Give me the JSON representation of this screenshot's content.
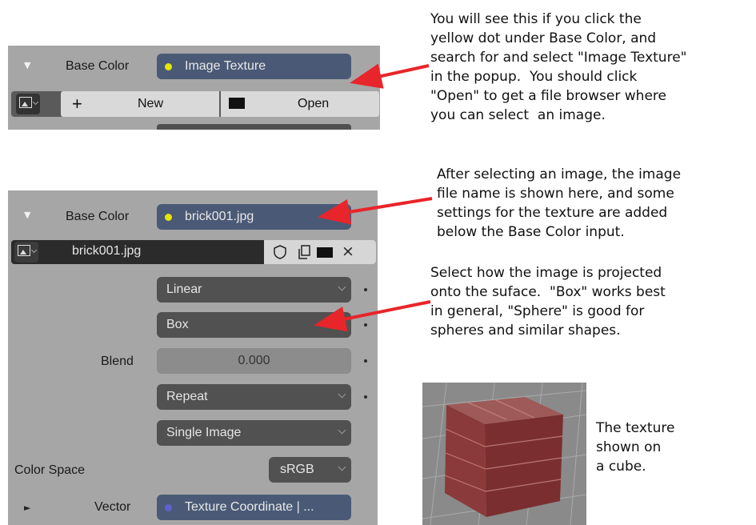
{
  "panel1": {
    "base_color_label": "Base Color",
    "socket_value": "Image Texture",
    "socket_dot_color": "#e6e600",
    "new_label": "New",
    "open_label": "Open"
  },
  "note1": "You will see this if you click the\nyellow dot under Base Color, and\nsearch for and select \"Image Texture\"\nin the popup.  You should click\n\"Open\" to get a file browser where\nyou can select  an image.",
  "note2": "After selecting an image, the image\nfile name is shown here, and some\nsettings for the texture are added\nbelow the Base Color input.",
  "note3": "Select how the image is projected\nonto the suface.  \"Box\" works best\nin general, \"Sphere\" is good for\nspheres and similar shapes.",
  "note4": "The texture\nshown on\na cube.",
  "panel2": {
    "base_color_label": "Base Color",
    "socket_value": "brick001.jpg",
    "socket_dot_color": "#e6e600",
    "image_name": "brick001.jpg",
    "interpolation": "Linear",
    "projection": "Box",
    "blend_label": "Blend",
    "blend_value": "0.000",
    "extension": "Repeat",
    "source": "Single Image",
    "color_space_label": "Color Space",
    "color_space_value": "sRGB",
    "vector_label": "Vector",
    "vector_value": "Texture Coordinate | ...",
    "vector_dot_color": "#6060d0"
  },
  "colors": {
    "arrow": "#e8252a",
    "panel_bg": "#a6a6a6",
    "socket_bg": "#4a5a76",
    "dropdown_bg": "#515151"
  }
}
